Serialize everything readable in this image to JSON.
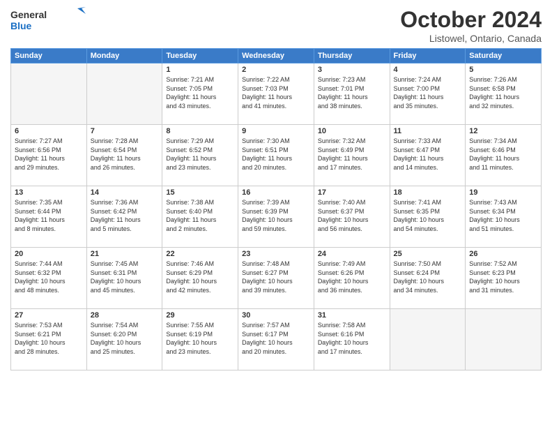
{
  "header": {
    "logo_line1": "General",
    "logo_line2": "Blue",
    "month": "October 2024",
    "location": "Listowel, Ontario, Canada"
  },
  "weekdays": [
    "Sunday",
    "Monday",
    "Tuesday",
    "Wednesday",
    "Thursday",
    "Friday",
    "Saturday"
  ],
  "weeks": [
    [
      {
        "day": "",
        "info": ""
      },
      {
        "day": "",
        "info": ""
      },
      {
        "day": "1",
        "info": "Sunrise: 7:21 AM\nSunset: 7:05 PM\nDaylight: 11 hours\nand 43 minutes."
      },
      {
        "day": "2",
        "info": "Sunrise: 7:22 AM\nSunset: 7:03 PM\nDaylight: 11 hours\nand 41 minutes."
      },
      {
        "day": "3",
        "info": "Sunrise: 7:23 AM\nSunset: 7:01 PM\nDaylight: 11 hours\nand 38 minutes."
      },
      {
        "day": "4",
        "info": "Sunrise: 7:24 AM\nSunset: 7:00 PM\nDaylight: 11 hours\nand 35 minutes."
      },
      {
        "day": "5",
        "info": "Sunrise: 7:26 AM\nSunset: 6:58 PM\nDaylight: 11 hours\nand 32 minutes."
      }
    ],
    [
      {
        "day": "6",
        "info": "Sunrise: 7:27 AM\nSunset: 6:56 PM\nDaylight: 11 hours\nand 29 minutes."
      },
      {
        "day": "7",
        "info": "Sunrise: 7:28 AM\nSunset: 6:54 PM\nDaylight: 11 hours\nand 26 minutes."
      },
      {
        "day": "8",
        "info": "Sunrise: 7:29 AM\nSunset: 6:52 PM\nDaylight: 11 hours\nand 23 minutes."
      },
      {
        "day": "9",
        "info": "Sunrise: 7:30 AM\nSunset: 6:51 PM\nDaylight: 11 hours\nand 20 minutes."
      },
      {
        "day": "10",
        "info": "Sunrise: 7:32 AM\nSunset: 6:49 PM\nDaylight: 11 hours\nand 17 minutes."
      },
      {
        "day": "11",
        "info": "Sunrise: 7:33 AM\nSunset: 6:47 PM\nDaylight: 11 hours\nand 14 minutes."
      },
      {
        "day": "12",
        "info": "Sunrise: 7:34 AM\nSunset: 6:46 PM\nDaylight: 11 hours\nand 11 minutes."
      }
    ],
    [
      {
        "day": "13",
        "info": "Sunrise: 7:35 AM\nSunset: 6:44 PM\nDaylight: 11 hours\nand 8 minutes."
      },
      {
        "day": "14",
        "info": "Sunrise: 7:36 AM\nSunset: 6:42 PM\nDaylight: 11 hours\nand 5 minutes."
      },
      {
        "day": "15",
        "info": "Sunrise: 7:38 AM\nSunset: 6:40 PM\nDaylight: 11 hours\nand 2 minutes."
      },
      {
        "day": "16",
        "info": "Sunrise: 7:39 AM\nSunset: 6:39 PM\nDaylight: 10 hours\nand 59 minutes."
      },
      {
        "day": "17",
        "info": "Sunrise: 7:40 AM\nSunset: 6:37 PM\nDaylight: 10 hours\nand 56 minutes."
      },
      {
        "day": "18",
        "info": "Sunrise: 7:41 AM\nSunset: 6:35 PM\nDaylight: 10 hours\nand 54 minutes."
      },
      {
        "day": "19",
        "info": "Sunrise: 7:43 AM\nSunset: 6:34 PM\nDaylight: 10 hours\nand 51 minutes."
      }
    ],
    [
      {
        "day": "20",
        "info": "Sunrise: 7:44 AM\nSunset: 6:32 PM\nDaylight: 10 hours\nand 48 minutes."
      },
      {
        "day": "21",
        "info": "Sunrise: 7:45 AM\nSunset: 6:31 PM\nDaylight: 10 hours\nand 45 minutes."
      },
      {
        "day": "22",
        "info": "Sunrise: 7:46 AM\nSunset: 6:29 PM\nDaylight: 10 hours\nand 42 minutes."
      },
      {
        "day": "23",
        "info": "Sunrise: 7:48 AM\nSunset: 6:27 PM\nDaylight: 10 hours\nand 39 minutes."
      },
      {
        "day": "24",
        "info": "Sunrise: 7:49 AM\nSunset: 6:26 PM\nDaylight: 10 hours\nand 36 minutes."
      },
      {
        "day": "25",
        "info": "Sunrise: 7:50 AM\nSunset: 6:24 PM\nDaylight: 10 hours\nand 34 minutes."
      },
      {
        "day": "26",
        "info": "Sunrise: 7:52 AM\nSunset: 6:23 PM\nDaylight: 10 hours\nand 31 minutes."
      }
    ],
    [
      {
        "day": "27",
        "info": "Sunrise: 7:53 AM\nSunset: 6:21 PM\nDaylight: 10 hours\nand 28 minutes."
      },
      {
        "day": "28",
        "info": "Sunrise: 7:54 AM\nSunset: 6:20 PM\nDaylight: 10 hours\nand 25 minutes."
      },
      {
        "day": "29",
        "info": "Sunrise: 7:55 AM\nSunset: 6:19 PM\nDaylight: 10 hours\nand 23 minutes."
      },
      {
        "day": "30",
        "info": "Sunrise: 7:57 AM\nSunset: 6:17 PM\nDaylight: 10 hours\nand 20 minutes."
      },
      {
        "day": "31",
        "info": "Sunrise: 7:58 AM\nSunset: 6:16 PM\nDaylight: 10 hours\nand 17 minutes."
      },
      {
        "day": "",
        "info": ""
      },
      {
        "day": "",
        "info": ""
      }
    ]
  ]
}
